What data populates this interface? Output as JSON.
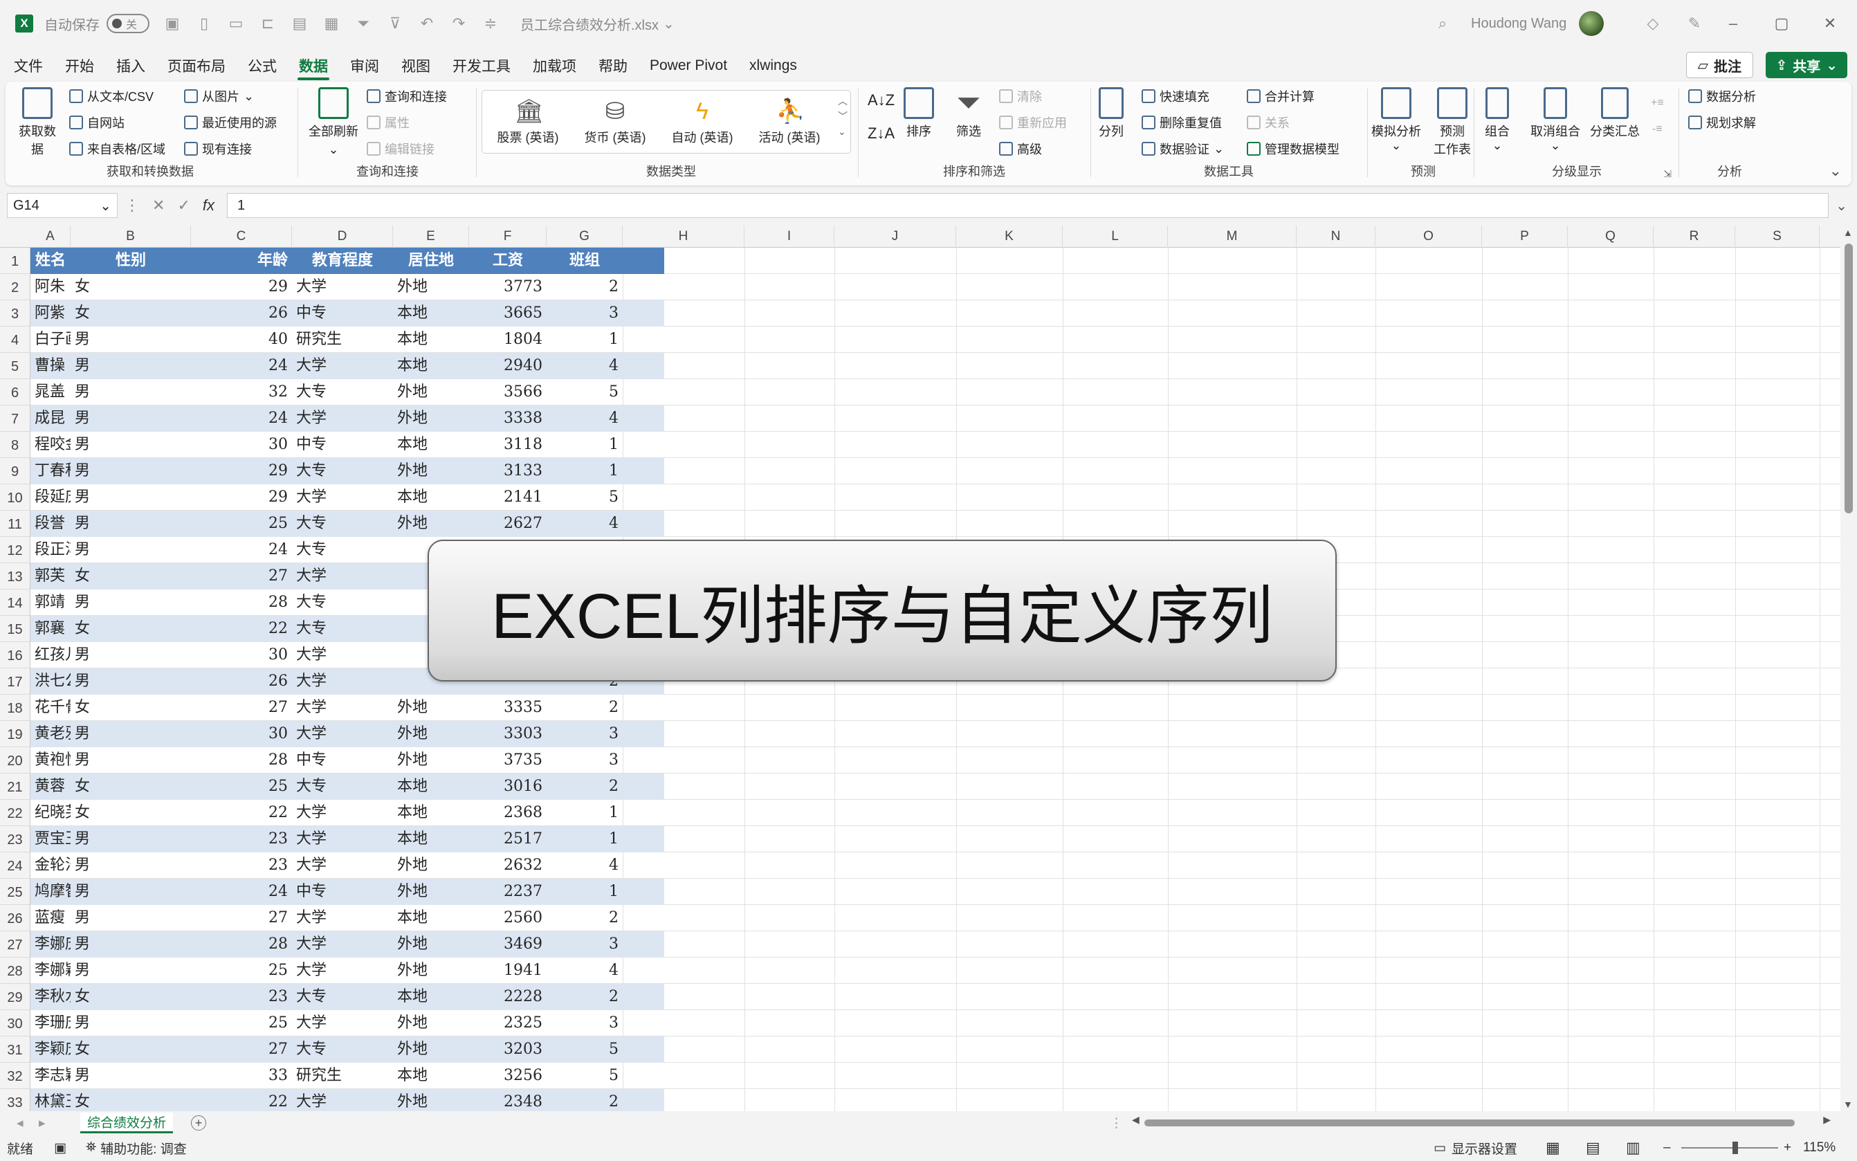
{
  "titlebar": {
    "autosave_label": "自动保存",
    "autosave_state": "关",
    "filename": "员工综合绩效分析.xlsx",
    "user": "Houdong Wang"
  },
  "menu": {
    "tabs": [
      "文件",
      "开始",
      "插入",
      "页面布局",
      "公式",
      "数据",
      "审阅",
      "视图",
      "开发工具",
      "加载项",
      "帮助",
      "Power Pivot",
      "xlwings"
    ],
    "active_index": 5,
    "comment_label": "批注",
    "share_label": "共享"
  },
  "ribbon": {
    "get_data": {
      "big": "获取数据",
      "from_text": "从文本/CSV",
      "from_web": "自网站",
      "from_table": "来自表格/区域",
      "from_picture": "从图片",
      "recent_sources": "最近使用的源",
      "existing_connections": "现有连接",
      "label": "获取和转换数据"
    },
    "queries": {
      "refresh_all": "全部刷新",
      "queries_connections": "查询和连接",
      "properties": "属性",
      "edit_links": "编辑链接",
      "label": "查询和连接"
    },
    "data_types": {
      "stocks": "股票 (英语)",
      "currencies": "货币 (英语)",
      "automatic": "自动 (英语)",
      "activity": "活动 (英语)",
      "label": "数据类型"
    },
    "sort_filter": {
      "sort": "排序",
      "filter": "筛选",
      "clear": "清除",
      "reapply": "重新应用",
      "advanced": "高级",
      "label": "排序和筛选"
    },
    "data_tools": {
      "text_to_columns": "分列",
      "flash_fill": "快速填充",
      "remove_duplicates": "删除重复值",
      "data_validation": "数据验证",
      "consolidate": "合并计算",
      "relationships": "关系",
      "manage_model": "管理数据模型",
      "label": "数据工具"
    },
    "forecast": {
      "what_if": "模拟分析",
      "forecast_sheet_1": "预测",
      "forecast_sheet_2": "工作表",
      "label": "预测"
    },
    "outline": {
      "group": "组合",
      "ungroup": "取消组合",
      "subtotal": "分类汇总",
      "label": "分级显示"
    },
    "analysis": {
      "data_analysis": "数据分析",
      "solver": "规划求解",
      "label": "分析"
    }
  },
  "formula_bar": {
    "name_box": "G14",
    "fx": "fx",
    "value": "1"
  },
  "columns": [
    "A",
    "B",
    "C",
    "D",
    "E",
    "F",
    "G",
    "H",
    "I",
    "J",
    "K",
    "L",
    "M",
    "N",
    "O",
    "P",
    "Q",
    "R",
    "S"
  ],
  "table": {
    "headers": [
      "姓名",
      "性别",
      "年龄",
      "教育程度",
      "居住地",
      "工资",
      "班组"
    ],
    "rows": [
      [
        "阿朱",
        "女",
        "29",
        "大学",
        "外地",
        "3773",
        "2"
      ],
      [
        "阿紫",
        "女",
        "26",
        "中专",
        "本地",
        "3665",
        "3"
      ],
      [
        "白子画",
        "男",
        "40",
        "研究生",
        "本地",
        "1804",
        "1"
      ],
      [
        "曹操",
        "男",
        "24",
        "大学",
        "本地",
        "2940",
        "4"
      ],
      [
        "晁盖",
        "男",
        "32",
        "大专",
        "外地",
        "3566",
        "5"
      ],
      [
        "成昆",
        "男",
        "24",
        "大学",
        "外地",
        "3338",
        "4"
      ],
      [
        "程咬金",
        "男",
        "30",
        "中专",
        "本地",
        "3118",
        "1"
      ],
      [
        "丁春秋",
        "男",
        "29",
        "大专",
        "外地",
        "3133",
        "1"
      ],
      [
        "段延庆",
        "男",
        "29",
        "大学",
        "本地",
        "2141",
        "5"
      ],
      [
        "段誉",
        "男",
        "25",
        "大专",
        "外地",
        "2627",
        "4"
      ],
      [
        "段正淳",
        "男",
        "24",
        "大专",
        "",
        "",
        ""
      ],
      [
        "郭芙",
        "女",
        "27",
        "大学",
        "",
        "",
        ""
      ],
      [
        "郭靖",
        "男",
        "28",
        "大专",
        "",
        "",
        ""
      ],
      [
        "郭襄",
        "女",
        "22",
        "大专",
        "",
        "",
        ""
      ],
      [
        "红孩儿",
        "男",
        "30",
        "大学",
        "",
        "",
        ""
      ],
      [
        "洪七公",
        "男",
        "26",
        "大学",
        "",
        "",
        "2"
      ],
      [
        "花千骨",
        "女",
        "27",
        "大学",
        "外地",
        "3335",
        "2"
      ],
      [
        "黄老邪",
        "男",
        "30",
        "大学",
        "外地",
        "3303",
        "3"
      ],
      [
        "黄袍怪",
        "男",
        "28",
        "中专",
        "外地",
        "3735",
        "3"
      ],
      [
        "黄蓉",
        "女",
        "25",
        "大专",
        "本地",
        "3016",
        "2"
      ],
      [
        "纪晓芙",
        "女",
        "22",
        "大学",
        "本地",
        "2368",
        "1"
      ],
      [
        "贾宝玉",
        "男",
        "23",
        "大学",
        "本地",
        "2517",
        "1"
      ],
      [
        "金轮法王",
        "男",
        "23",
        "大学",
        "外地",
        "2632",
        "4"
      ],
      [
        "鸠摩智",
        "男",
        "24",
        "中专",
        "外地",
        "2237",
        "1"
      ],
      [
        "蓝瘦",
        "男",
        "27",
        "大学",
        "本地",
        "2560",
        "2"
      ],
      [
        "李娜庆",
        "男",
        "28",
        "大学",
        "外地",
        "3469",
        "3"
      ],
      [
        "李娜颖",
        "男",
        "25",
        "大学",
        "外地",
        "1941",
        "4"
      ],
      [
        "李秋水",
        "女",
        "23",
        "大专",
        "本地",
        "2228",
        "2"
      ],
      [
        "李珊庆",
        "男",
        "25",
        "大学",
        "外地",
        "2325",
        "3"
      ],
      [
        "李颖庆",
        "女",
        "27",
        "大专",
        "外地",
        "3203",
        "5"
      ],
      [
        "李志颖",
        "男",
        "33",
        "研究生",
        "本地",
        "3256",
        "5"
      ],
      [
        "林黛玉",
        "女",
        "22",
        "大学",
        "外地",
        "2348",
        "2"
      ]
    ]
  },
  "banner": "EXCEL列排序与自定义序列",
  "sheet_tab": "综合绩效分析",
  "status": {
    "ready": "就绪",
    "accessibility": "辅助功能: 调查",
    "display_settings": "显示器设置",
    "zoom": "115%"
  },
  "colors": {
    "accent": "#107c41",
    "header_fill": "#4f81bd",
    "band_fill": "#dce6f2"
  }
}
